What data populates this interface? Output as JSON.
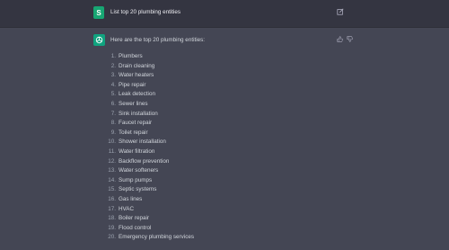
{
  "user_message": {
    "avatar_letter": "S",
    "text": "List top 20 plumbing entities"
  },
  "assistant_message": {
    "intro": "Here are the top 20 plumbing entities:",
    "items": [
      {
        "num": "1.",
        "label": "Plumbers"
      },
      {
        "num": "2.",
        "label": "Drain cleaning"
      },
      {
        "num": "3.",
        "label": "Water heaters"
      },
      {
        "num": "4.",
        "label": "Pipe repair"
      },
      {
        "num": "5.",
        "label": "Leak detection"
      },
      {
        "num": "6.",
        "label": "Sewer lines"
      },
      {
        "num": "7.",
        "label": "Sink installation"
      },
      {
        "num": "8.",
        "label": "Faucet repair"
      },
      {
        "num": "9.",
        "label": "Toilet repair"
      },
      {
        "num": "10.",
        "label": "Shower installation"
      },
      {
        "num": "11.",
        "label": "Water filtration"
      },
      {
        "num": "12.",
        "label": "Backflow prevention"
      },
      {
        "num": "13.",
        "label": "Water softeners"
      },
      {
        "num": "14.",
        "label": "Sump pumps"
      },
      {
        "num": "15.",
        "label": "Septic systems"
      },
      {
        "num": "16.",
        "label": "Gas lines"
      },
      {
        "num": "17.",
        "label": "HVAC"
      },
      {
        "num": "18.",
        "label": "Boiler repair"
      },
      {
        "num": "19.",
        "label": "Flood control"
      },
      {
        "num": "20.",
        "label": "Emergency plumbing services"
      }
    ]
  },
  "icons": {
    "edit": "edit-icon",
    "thumbs_up": "thumbs-up-icon",
    "thumbs_down": "thumbs-down-icon",
    "bot": "openai-logo-icon"
  },
  "colors": {
    "user_row_bg": "#343541",
    "assistant_row_bg": "#444654",
    "user_avatar": "#17a673",
    "bot_avatar": "#10a37f"
  }
}
